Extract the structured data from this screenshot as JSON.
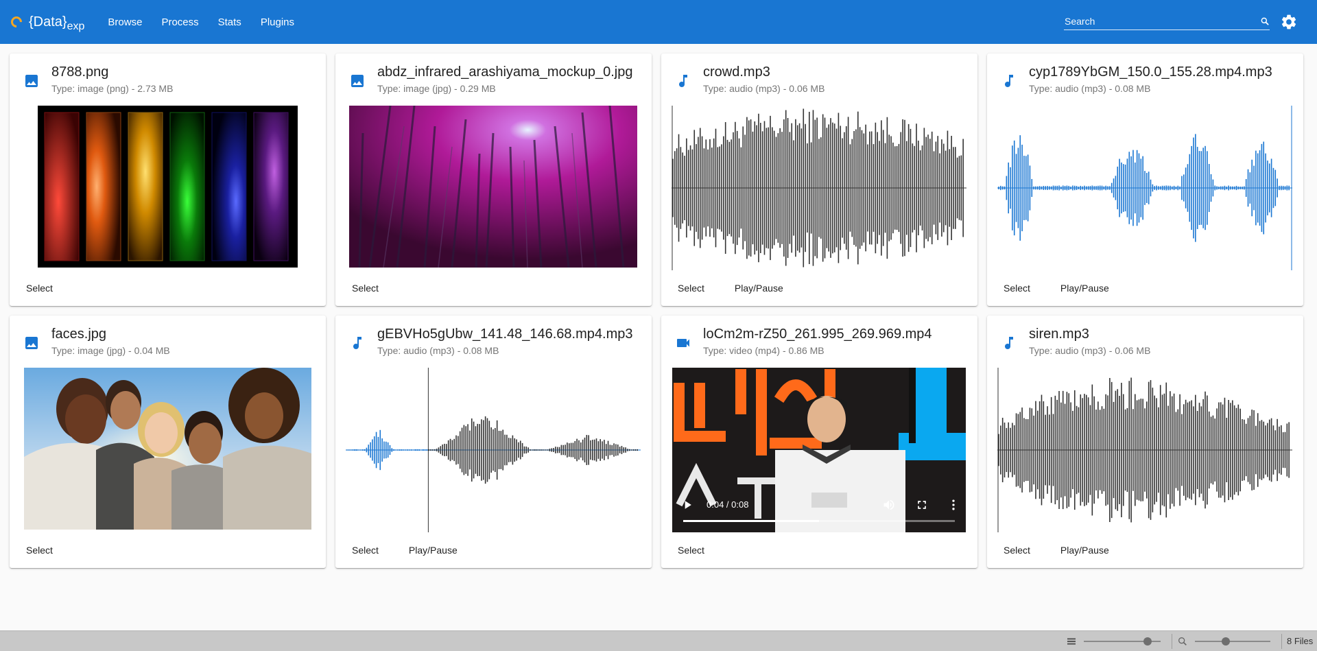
{
  "app": {
    "logo_text": "{Data}",
    "logo_sub": "exp",
    "nav": [
      "Browse",
      "Process",
      "Stats",
      "Plugins"
    ],
    "search_placeholder": "Search",
    "accent_color": "#1976d2"
  },
  "cards": [
    {
      "title": "8788.png",
      "subtitle": "Type: image (png) - 2.73 MB",
      "icon": "image-icon",
      "actions": [
        "Select"
      ]
    },
    {
      "title": "abdz_infrared_arashiyama_mockup_0.jpg",
      "subtitle": "Type: image (jpg) - 0.29 MB",
      "icon": "image-icon",
      "actions": [
        "Select"
      ]
    },
    {
      "title": "crowd.mp3",
      "subtitle": "Type: audio (mp3) - 0.06 MB",
      "icon": "music-note-icon",
      "actions": [
        "Select",
        "Play/Pause"
      ]
    },
    {
      "title": "cyp1789YbGM_150.0_155.28.mp4.mp3",
      "subtitle": "Type: audio (mp3) - 0.08 MB",
      "icon": "music-note-icon",
      "actions": [
        "Select",
        "Play/Pause"
      ]
    },
    {
      "title": "faces.jpg",
      "subtitle": "Type: image (jpg) - 0.04 MB",
      "icon": "image-icon",
      "actions": [
        "Select"
      ]
    },
    {
      "title": "gEBVHo5gUbw_141.48_146.68.mp4.mp3",
      "subtitle": "Type: audio (mp3) - 0.08 MB",
      "icon": "music-note-icon",
      "actions": [
        "Select",
        "Play/Pause"
      ]
    },
    {
      "title": "loCm2m-rZ50_261.995_269.969.mp4",
      "subtitle": "Type: video (mp4) - 0.86 MB",
      "icon": "videocam-icon",
      "actions": [
        "Select"
      ]
    },
    {
      "title": "siren.mp3",
      "subtitle": "Type: audio (mp3) - 0.06 MB",
      "icon": "music-note-icon",
      "actions": [
        "Select",
        "Play/Pause"
      ]
    }
  ],
  "video": {
    "time": "0:04 / 0:08",
    "progress": 0.5
  },
  "audio_progress": {
    "crowd": 0.0,
    "cyp": 1.0,
    "gEBV": 0.28,
    "siren": 0.0
  },
  "statusbar": {
    "files_count": "8 Files",
    "size_level": 0.78,
    "zoom_level": 0.35
  }
}
